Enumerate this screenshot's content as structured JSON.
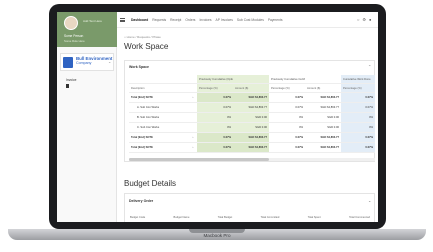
{
  "device": {
    "label": "Macbook Pro"
  },
  "sidebar": {
    "tagline": "Add Text Here",
    "user_name": "Some Person",
    "user_role": "Some Role Here",
    "logo_line1": "Bull Environment",
    "logo_line2": "Company",
    "items": [
      {
        "label": "Invoice"
      }
    ]
  },
  "topnav": {
    "items": [
      "Dashboard",
      "Requests",
      "Receipt",
      "Orders",
      "Invoices",
      "AP Invoices",
      "Sub Cost Modules",
      "Payments"
    ],
    "active": "Dashboard"
  },
  "breadcrumb": "⌂  Home  /  Requests  /  Phase",
  "page_title": "Work Space",
  "workspace_panel": {
    "title": "Work Space",
    "group_headers": [
      "",
      "",
      "Previously Cumulative (Option)",
      "",
      "Previously Cumulative Certified",
      "",
      "Cumulative Work Done"
    ],
    "columns": [
      "Description",
      "",
      "Percentage (%)",
      "Amount ($)",
      "Percentage (%)",
      "Amount ($)",
      "Percentage (%)"
    ],
    "rows": [
      {
        "desc": "Total [End] SOTE",
        "p1": "0.07%",
        "a1": "SGD 64,863.77",
        "p2": "0.07%",
        "a2": "SGD 64,863.77",
        "p3": "0.07%",
        "total": true
      },
      {
        "desc": "A. Sub Con Works",
        "p1": "0.07%",
        "a1": "SGD 64,863.77",
        "p2": "0.07%",
        "a2": "SGD 64,863.77",
        "p3": "0.07%",
        "total": false
      },
      {
        "desc": "B. Sub Con Works",
        "p1": "0%",
        "a1": "SGD 0.00",
        "p2": "0%",
        "a2": "SGD 0.00",
        "p3": "0%",
        "total": false
      },
      {
        "desc": "C. Sub Con Works",
        "p1": "0%",
        "a1": "SGD 0.00",
        "p2": "0%",
        "a2": "SGD 0.00",
        "p3": "0%",
        "total": false
      },
      {
        "desc": "Total [End] SOTE",
        "p1": "0.07%",
        "a1": "SGD 64,863.77",
        "p2": "0.07%",
        "a2": "SGD 64,863.77",
        "p3": "0.07%",
        "total": true
      },
      {
        "desc": "Total [End] SOTE",
        "p1": "0.07%",
        "a1": "SGD 64,863.77",
        "p2": "0.07%",
        "a2": "SGD 64,863.77",
        "p3": "0.07%",
        "total": true
      }
    ]
  },
  "budget": {
    "title": "Budget Details",
    "panel_title": "Delivery Order",
    "columns": [
      "Budget Code",
      "Budget Name",
      "Total Budget",
      "Total Committed",
      "Total Spent",
      "Total Commenced"
    ]
  },
  "colors": {
    "sidebar_header": "#7a9a6a",
    "accent": "#2f63c2",
    "col_green": "#e6f0d8",
    "col_blue": "#e3edf7"
  }
}
